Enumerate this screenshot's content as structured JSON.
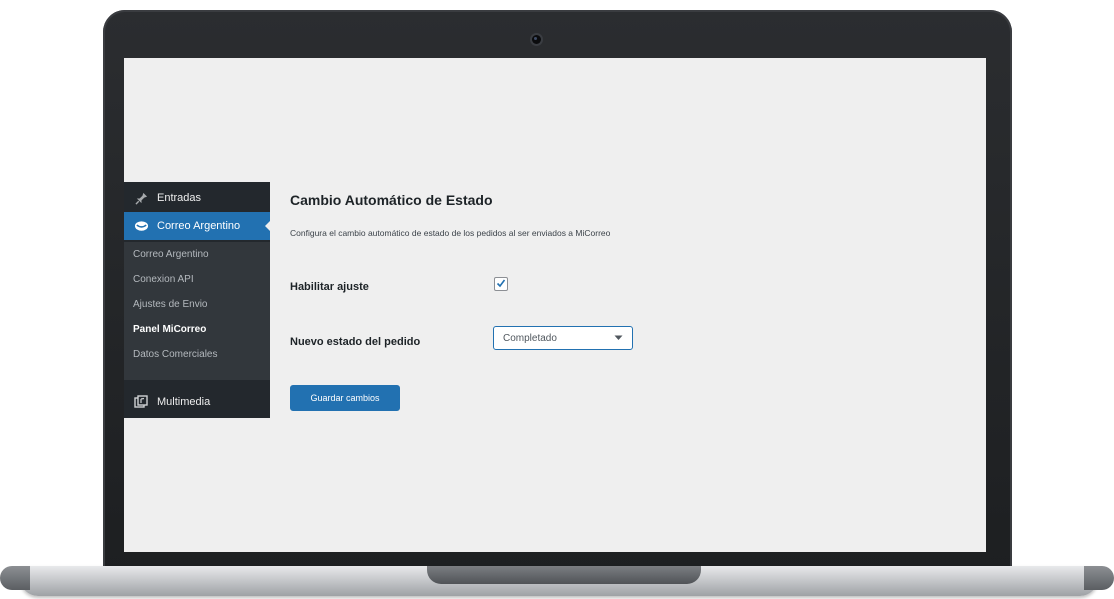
{
  "sidebar": {
    "items": [
      {
        "label": "Entradas",
        "icon": "pin-icon"
      },
      {
        "label": "Correo Argentino",
        "icon": "correo-argentino-icon",
        "active": true
      },
      {
        "label": "Multimedia",
        "icon": "media-icon"
      }
    ],
    "submenu": [
      {
        "label": "Correo Argentino"
      },
      {
        "label": "Conexion API"
      },
      {
        "label": "Ajustes de Envio"
      },
      {
        "label": "Panel MiCorreo",
        "current": true
      },
      {
        "label": "Datos Comerciales"
      }
    ]
  },
  "main": {
    "title": "Cambio Automático de Estado",
    "description": "Configura el cambio automático de estado de los pedidos al ser enviados a MiCorreo",
    "enable_label": "Habilitar ajuste",
    "enable_checked": true,
    "status_label": "Nuevo estado del pedido",
    "status_value": "Completado",
    "save_label": "Guardar cambios"
  },
  "colors": {
    "accent": "#2271b1",
    "sidebar_bg": "#23282d",
    "screen_bg": "#efefef"
  }
}
